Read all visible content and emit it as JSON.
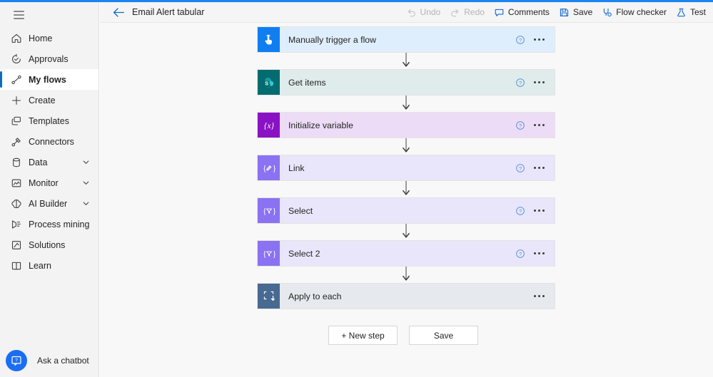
{
  "theme": {
    "accent_blue": "#1a84f0",
    "active_indicator": "#0f6cbd",
    "canvas_bg": "#f8f8f8",
    "sidebar_bg": "#f3f3f3"
  },
  "sidebar": {
    "menu_button": "Menu",
    "items": [
      {
        "label": "Home",
        "icon": "home-icon",
        "active": false,
        "expandable": false
      },
      {
        "label": "Approvals",
        "icon": "approvals-icon",
        "active": false,
        "expandable": false
      },
      {
        "label": "My flows",
        "icon": "my-flows-icon",
        "active": true,
        "expandable": false
      },
      {
        "label": "Create",
        "icon": "plus-icon",
        "active": false,
        "expandable": false
      },
      {
        "label": "Templates",
        "icon": "templates-icon",
        "active": false,
        "expandable": false
      },
      {
        "label": "Connectors",
        "icon": "connectors-icon",
        "active": false,
        "expandable": false
      },
      {
        "label": "Data",
        "icon": "database-icon",
        "active": false,
        "expandable": true
      },
      {
        "label": "Monitor",
        "icon": "monitor-icon",
        "active": false,
        "expandable": true
      },
      {
        "label": "AI Builder",
        "icon": "ai-builder-icon",
        "active": false,
        "expandable": true
      },
      {
        "label": "Process mining",
        "icon": "process-mining-icon",
        "active": false,
        "expandable": false
      },
      {
        "label": "Solutions",
        "icon": "solutions-icon",
        "active": false,
        "expandable": false
      },
      {
        "label": "Learn",
        "icon": "learn-icon",
        "active": false,
        "expandable": false
      }
    ],
    "chatbot": {
      "label": "Ask a chatbot",
      "icon": "chatbot-icon",
      "circle_color": "#1b6ef3"
    }
  },
  "topbar": {
    "back_label": "Back",
    "back_icon": "arrow-left-icon",
    "flow_title": "Email Alert tabular",
    "commands": [
      {
        "label": "Undo",
        "icon": "undo-icon",
        "disabled": true
      },
      {
        "label": "Redo",
        "icon": "redo-icon",
        "disabled": true
      },
      {
        "label": "Comments",
        "icon": "comment-icon",
        "disabled": false
      },
      {
        "label": "Save",
        "icon": "save-icon",
        "disabled": false
      },
      {
        "label": "Flow checker",
        "icon": "flow-checker-icon",
        "disabled": false
      },
      {
        "label": "Test",
        "icon": "test-flask-icon",
        "disabled": false
      }
    ]
  },
  "flow": {
    "nodes": [
      {
        "title": "Manually trigger a flow",
        "icon": "manual-trigger-icon",
        "icon_bg": "#0f7ef0",
        "card_bg": "#dfeefc",
        "has_help": true,
        "has_menu": true
      },
      {
        "title": "Get items",
        "icon": "sharepoint-icon",
        "icon_bg": "#036c70",
        "card_bg": "#dfeceb",
        "has_help": true,
        "has_menu": true
      },
      {
        "title": "Initialize variable",
        "icon": "variable-icon",
        "icon_bg": "#8a12c4",
        "card_bg": "#eddcf6",
        "has_help": true,
        "has_menu": true
      },
      {
        "title": "Link",
        "icon": "compose-icon",
        "icon_bg": "#8b72f2",
        "card_bg": "#e9e6fb",
        "has_help": true,
        "has_menu": true
      },
      {
        "title": "Select",
        "icon": "select-icon",
        "icon_bg": "#8b72f2",
        "card_bg": "#e9e6fb",
        "has_help": true,
        "has_menu": true
      },
      {
        "title": "Select 2",
        "icon": "select-icon",
        "icon_bg": "#8b72f2",
        "card_bg": "#e9e6fb",
        "has_help": true,
        "has_menu": true
      },
      {
        "title": "Apply to each",
        "icon": "apply-to-each-icon",
        "icon_bg": "#486991",
        "card_bg": "#e6e9ed",
        "has_help": false,
        "has_menu": true
      }
    ],
    "footer_buttons": [
      {
        "label": "+ New step",
        "name": "new-step-button"
      },
      {
        "label": "Save",
        "name": "save-button"
      }
    ]
  }
}
